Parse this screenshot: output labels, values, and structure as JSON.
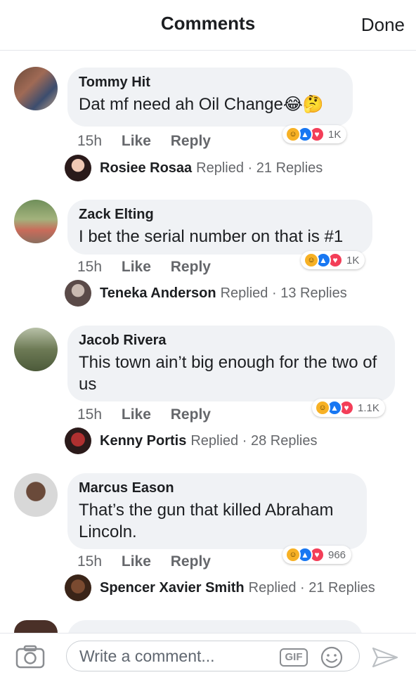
{
  "header": {
    "title": "Comments",
    "done_label": "Done"
  },
  "comments": [
    {
      "author": "Tommy Hit",
      "text": "Dat mf need ah Oil Change😂🤔",
      "time": "15h",
      "like_label": "Like",
      "reply_label": "Reply",
      "reaction_count": "1K",
      "reply": {
        "name": "Rosiee Rosaa",
        "meta": "Replied · 21 Replies"
      }
    },
    {
      "author": "Zack Elting",
      "text": "I bet the serial number on that is #1",
      "time": "15h",
      "like_label": "Like",
      "reply_label": "Reply",
      "reaction_count": "1K",
      "reply": {
        "name": "Teneka Anderson",
        "meta": "Replied · 13 Replies"
      }
    },
    {
      "author": "Jacob Rivera",
      "text": "This town ain’t big enough for the two of us",
      "time": "15h",
      "like_label": "Like",
      "reply_label": "Reply",
      "reaction_count": "1.1K",
      "reply": {
        "name": "Kenny Portis",
        "meta": "Replied · 28 Replies"
      }
    },
    {
      "author": "Marcus Eason",
      "text": "That’s the gun that killed Abraham Lincoln.",
      "time": "15h",
      "like_label": "Like",
      "reply_label": "Reply",
      "reaction_count": "966",
      "reply": {
        "name": "Spencer Xavier Smith",
        "meta": "Replied · 21 Replies"
      }
    }
  ],
  "reactions": [
    "haha",
    "like",
    "love"
  ],
  "composer": {
    "placeholder": "Write a comment...",
    "gif_label": "GIF"
  },
  "icons": {
    "camera": "camera-icon",
    "emoji": "smiley-icon",
    "send": "send-icon"
  },
  "colors": {
    "bubble": "#f0f2f5",
    "meta_text": "#65676b",
    "like_blue": "#1877f2",
    "love_red": "#f33e58",
    "haha_yellow": "#f7b125"
  }
}
